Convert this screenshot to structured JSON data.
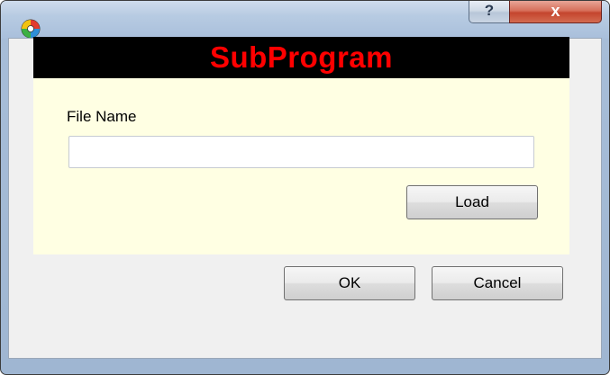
{
  "window": {
    "icon": "app-icon",
    "help_glyph": "?",
    "close_glyph": "x"
  },
  "banner": {
    "title": "SubProgram",
    "text_color": "#ff0000",
    "background_color": "#000000"
  },
  "form": {
    "file_name_label": "File Name",
    "file_name_value": "",
    "panel_color": "#ffffe3",
    "load_label": "Load"
  },
  "footer": {
    "ok_label": "OK",
    "cancel_label": "Cancel"
  }
}
